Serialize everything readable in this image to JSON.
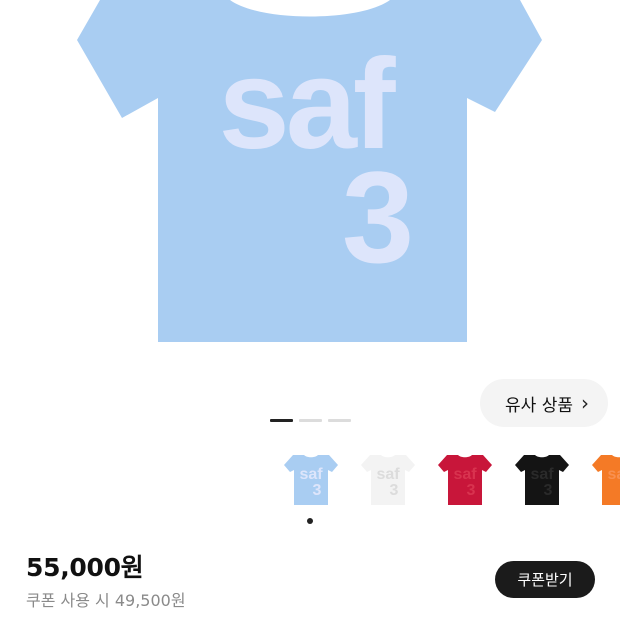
{
  "product_image": {
    "print_line1": "saf",
    "print_line2": "3",
    "shirt_color": "#a9cdf2",
    "print_color": "#dde5fb"
  },
  "similar_button": {
    "label": "유사 상품",
    "icon": "chevron-right-icon",
    "chevron": "›"
  },
  "carousel": {
    "total": 3,
    "active": 0
  },
  "color_options": [
    {
      "name": "sky-blue",
      "color": "#a9cdf2",
      "print": "#dde5fb",
      "selected": true
    },
    {
      "name": "white",
      "color": "#f3f3f3",
      "print": "#dcdcdc"
    },
    {
      "name": "red",
      "color": "#c8163a",
      "print": "#d8334f"
    },
    {
      "name": "black",
      "color": "#141414",
      "print": "#2a2a2a"
    },
    {
      "name": "orange",
      "color": "#f47a26",
      "print": "#f89050"
    }
  ],
  "price": {
    "amount": "55,000원",
    "coupon_text": "쿠폰 사용 시 49,500원",
    "coupon_button": "쿠폰받기"
  }
}
